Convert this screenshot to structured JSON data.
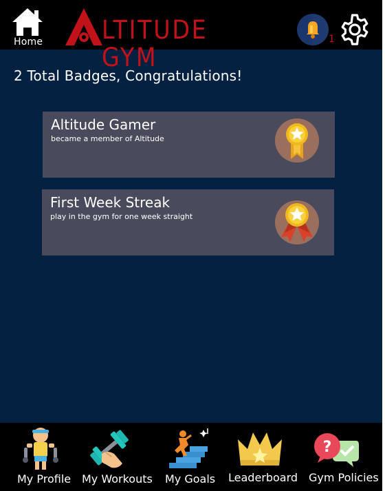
{
  "header": {
    "home_label": "Home",
    "logo_text": "LTITUDE GYM",
    "logo_letter": "A",
    "notification_count": "1",
    "brand_color": "#c1121a"
  },
  "summary": "2 Total Badges, Congratulations!",
  "badges": [
    {
      "title": "Altitude Gamer",
      "description": "became a member of Altitude",
      "medal_icon": "medal-gold-ribbon-icon"
    },
    {
      "title": "First Week Streak",
      "description": "play in the gym for one week straight",
      "medal_icon": "medal-red-ribbon-icon"
    }
  ],
  "nav": [
    {
      "label": "My Profile",
      "icon": "profile-icon"
    },
    {
      "label": "My Workouts",
      "icon": "dumbbell-icon"
    },
    {
      "label": "My Goals",
      "icon": "goals-stairs-icon"
    },
    {
      "label": "Leaderboard",
      "icon": "crown-icon"
    },
    {
      "label": "Gym Policies",
      "icon": "policies-icon"
    }
  ],
  "colors": {
    "background": "#052142",
    "card": "#494b5c",
    "bar": "#000000"
  }
}
